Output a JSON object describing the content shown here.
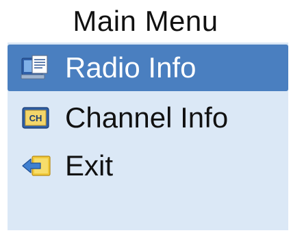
{
  "menu": {
    "title": "Main Menu",
    "items": [
      {
        "label": "Radio Info",
        "icon": "radio-info-icon",
        "selected": true
      },
      {
        "label": "Channel Info",
        "icon": "channel-info-icon",
        "icon_text": "CH",
        "selected": false
      },
      {
        "label": "Exit",
        "icon": "exit-icon",
        "selected": false
      }
    ]
  },
  "colors": {
    "panel_background": "#dbe8f6",
    "selected_background": "#4a7fc0",
    "selected_text": "#ffffff",
    "text": "#111111"
  }
}
